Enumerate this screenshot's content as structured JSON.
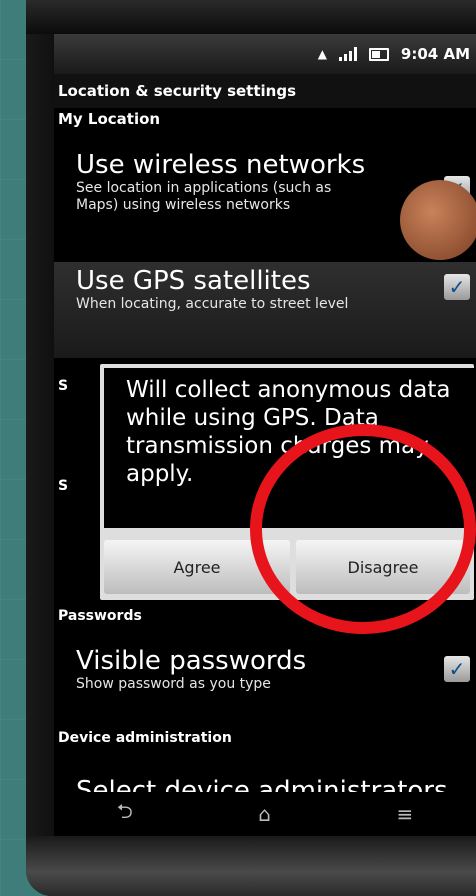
{
  "status_bar": {
    "time": "9:04 AM",
    "icons": [
      "alert-icon",
      "signal-icon",
      "battery-icon"
    ]
  },
  "screen_title": "Location & security settings",
  "sections": {
    "my_location": "My Location",
    "passwords": "Passwords",
    "device_admin": "Device administration"
  },
  "prefs": {
    "wireless": {
      "title": "Use wireless networks",
      "summary": "See location in applications (such as Maps) using wireless networks",
      "checked": true
    },
    "gps": {
      "title": "Use GPS satellites",
      "summary": "When locating, accurate to street level",
      "checked": true
    },
    "visible_passwords": {
      "title": "Visible passwords",
      "summary": "Show password as you type",
      "checked": true
    },
    "device_admins": {
      "title": "Select device administrators"
    }
  },
  "dialog": {
    "message": "Will collect anonymous data while using GPS. Data transmission charges may apply.",
    "agree_label": "Agree",
    "disagree_label": "Disagree"
  },
  "partial_side_letters": [
    "S",
    "S"
  ],
  "nav_icons": [
    "back-icon",
    "home-icon",
    "menu-icon"
  ],
  "colors": {
    "highlight_circle": "#e8141b",
    "background": "#3f7d7b"
  }
}
